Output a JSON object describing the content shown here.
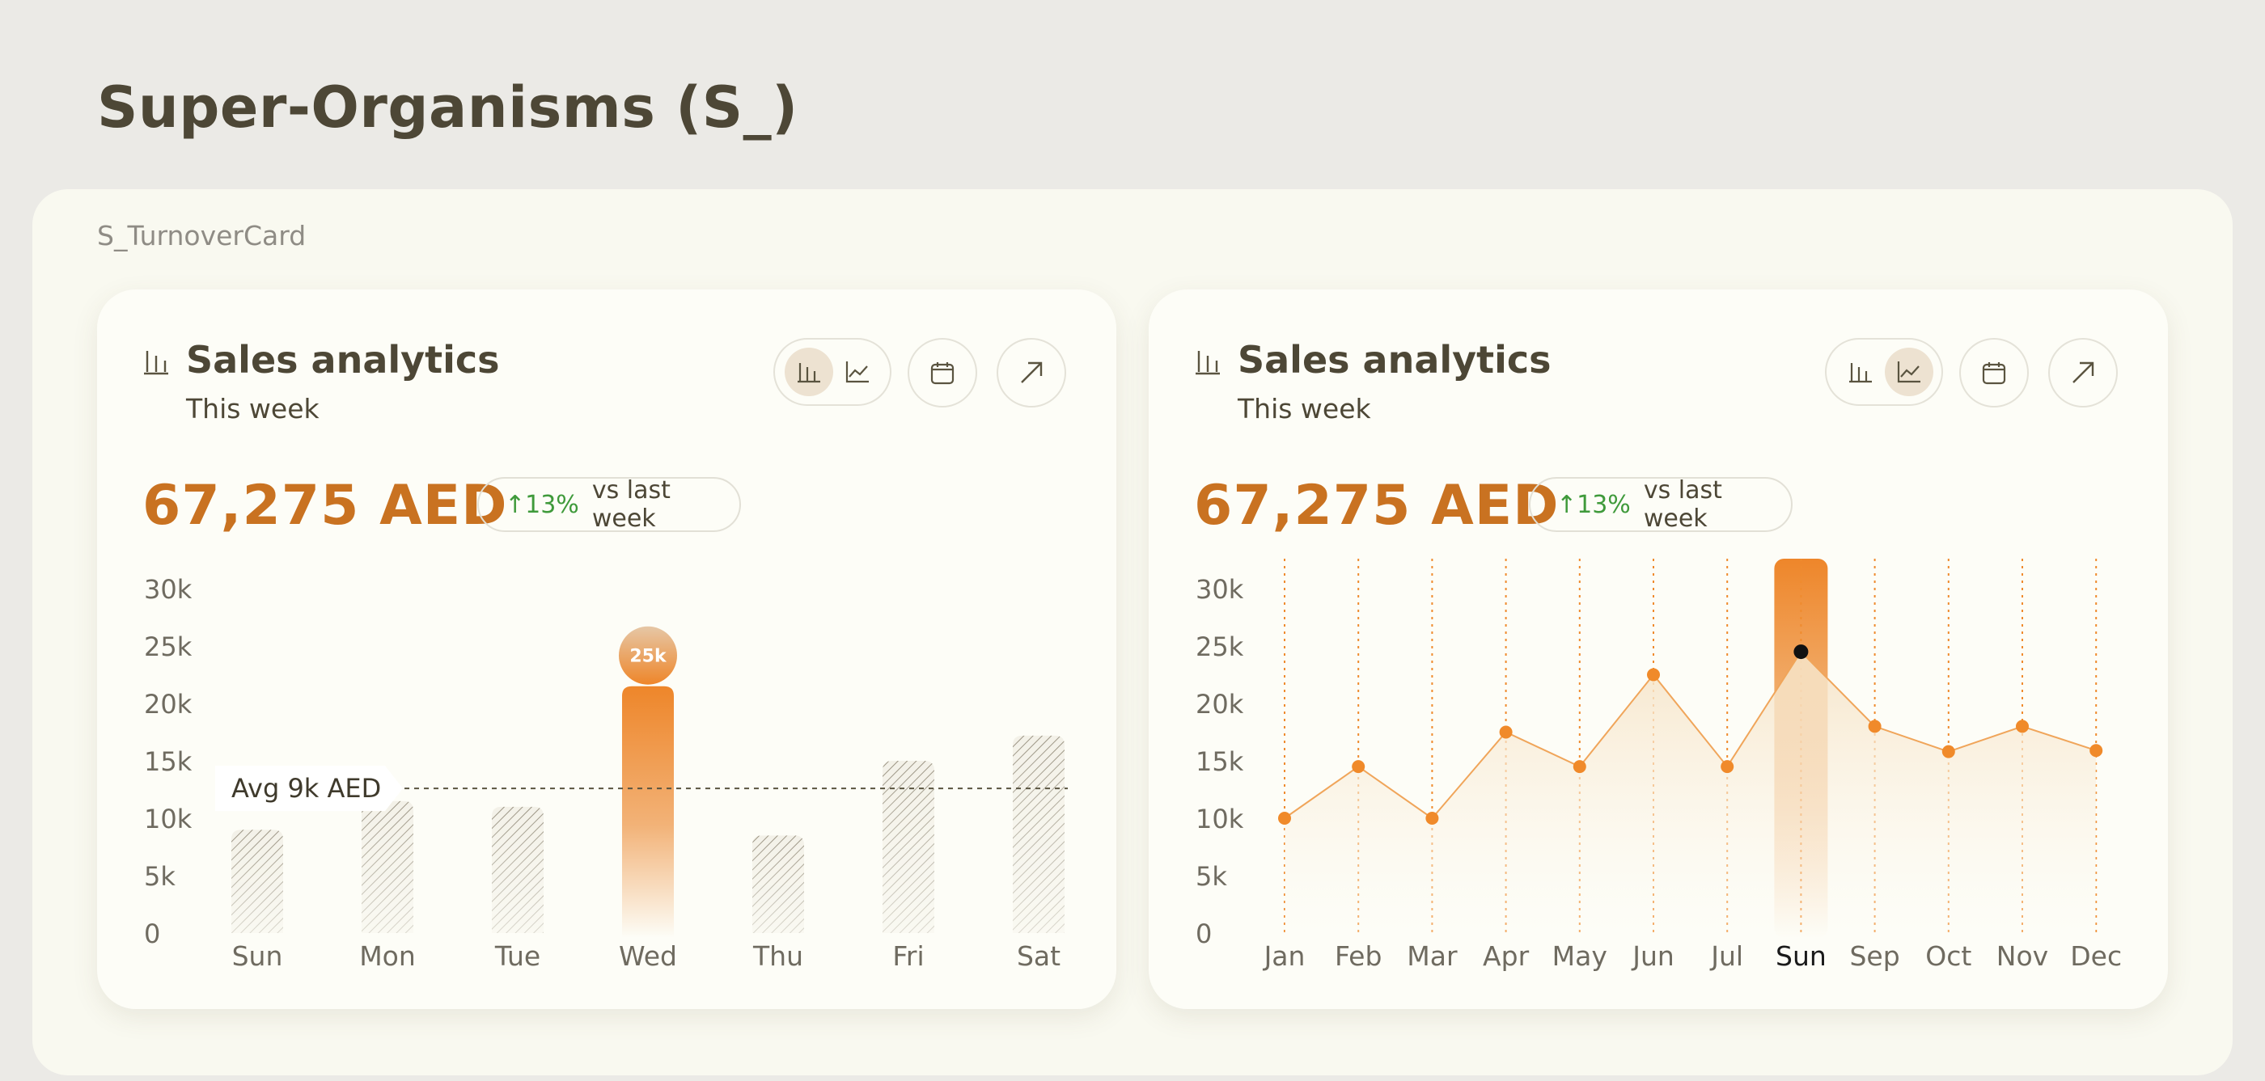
{
  "page": {
    "title": "Super-Organisms (S_)",
    "section_label": "S_TurnoverCard"
  },
  "colors": {
    "accent": "#c97221",
    "orange": "#f08a2a",
    "positive": "#3f9a3b",
    "hatch": "#9a9382",
    "text": "#4d4736"
  },
  "cards": [
    {
      "title": "Sales analytics",
      "subtitle": "This week",
      "title_icon": "bar-chart-icon",
      "amount": "67,275 AED",
      "change_pct": "↑13%",
      "change_label": "vs last week",
      "view_mode": "bar",
      "buttons": [
        "bar-chart-icon",
        "line-chart-icon",
        "calendar-icon",
        "expand-arrow-icon"
      ]
    },
    {
      "title": "Sales analytics",
      "subtitle": "This week",
      "title_icon": "bar-chart-icon",
      "amount": "67,275 AED",
      "change_pct": "↑13%",
      "change_label": "vs last week",
      "view_mode": "line",
      "buttons": [
        "bar-chart-icon",
        "line-chart-icon",
        "calendar-icon",
        "expand-arrow-icon"
      ]
    }
  ],
  "chart_data": [
    {
      "type": "bar",
      "categories": [
        "Sun",
        "Mon",
        "Tue",
        "Wed",
        "Thu",
        "Fri",
        "Sat"
      ],
      "values": [
        9000,
        11500,
        11000,
        21500,
        8500,
        15000,
        17200
      ],
      "highlight_index": 3,
      "highlight_label": "25k",
      "average": 12600,
      "average_label": "Avg 9k AED",
      "y_ticks": [
        "0",
        "5k",
        "10k",
        "15k",
        "20k",
        "25k",
        "30k"
      ],
      "ylim": [
        0,
        30000
      ]
    },
    {
      "type": "line",
      "categories": [
        "Jan",
        "Feb",
        "Mar",
        "Apr",
        "May",
        "Jun",
        "Jul",
        "Sun",
        "Sep",
        "Oct",
        "Nov",
        "Dec"
      ],
      "values": [
        10000,
        14500,
        10000,
        17500,
        14500,
        22500,
        14500,
        24500,
        18000,
        15800,
        18000,
        15900
      ],
      "highlight_index": 7,
      "y_ticks": [
        "0",
        "5k",
        "10k",
        "15k",
        "20k",
        "25k",
        "30k"
      ],
      "ylim": [
        0,
        30000
      ]
    }
  ]
}
